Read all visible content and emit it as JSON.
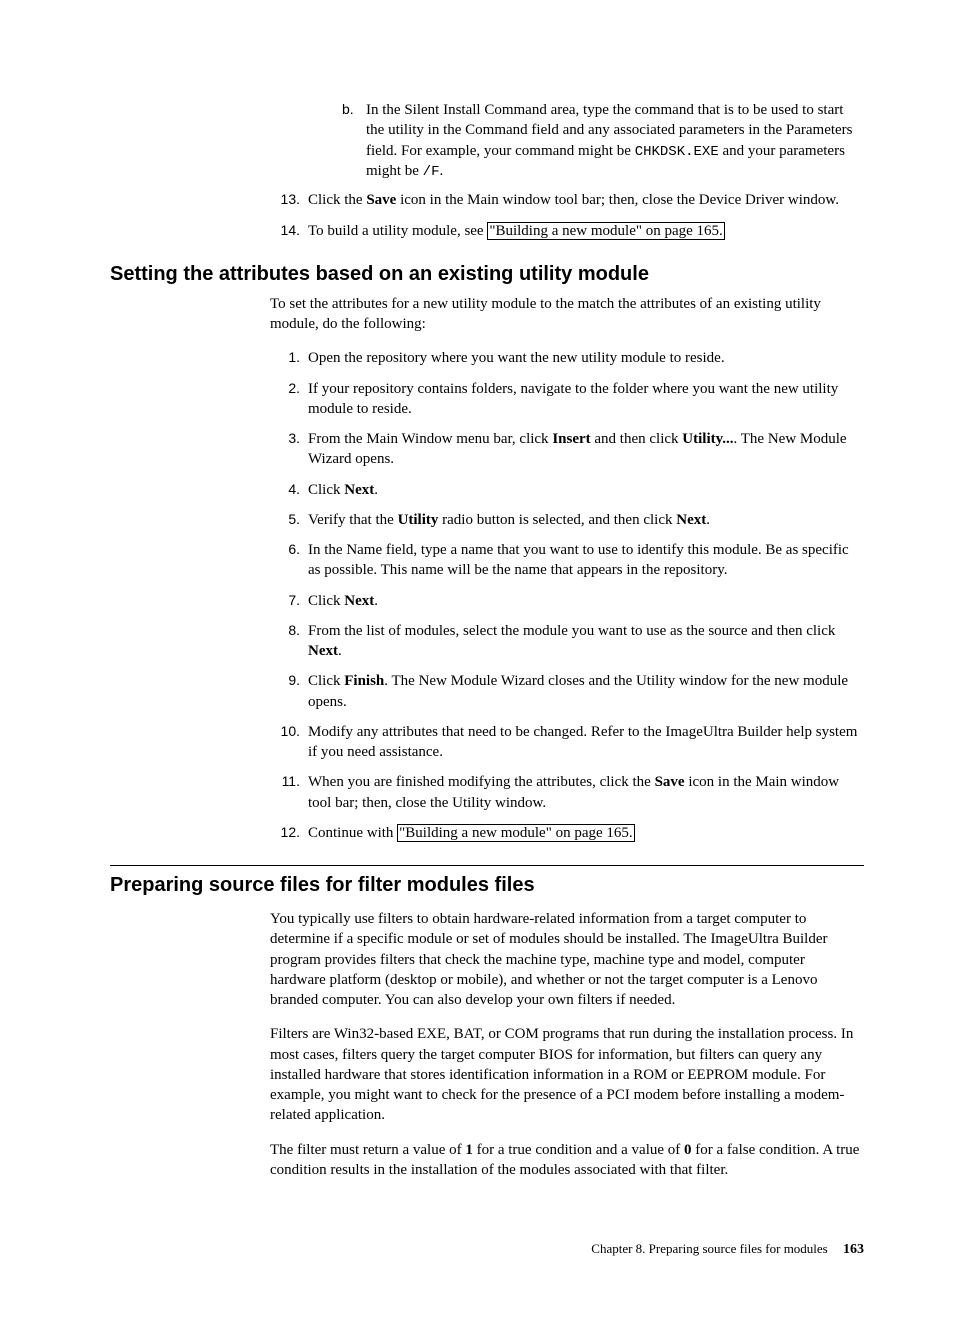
{
  "top_items": {
    "b": {
      "pre": "In the Silent Install Command area, type the command that is to be used to start the utility in the Command field and any associated parameters in the Parameters field. For example, your command might be ",
      "code1": "CHKDSK.EXE",
      "mid": " and your parameters might be ",
      "code2": "/F",
      "post": "."
    },
    "i13": {
      "pre": "Click the ",
      "bold": "Save",
      "post": " icon in the Main window tool bar; then, close the Device Driver window."
    },
    "i14": {
      "pre": "To build a utility module, see ",
      "link": "\"Building a new module\" on page 165."
    }
  },
  "section1": {
    "heading": "Setting the attributes based on an existing utility module",
    "intro": "To set the attributes for a new utility module to the match the attributes of an existing utility module, do the following:",
    "items": {
      "i1": "Open the repository where you want the new utility module to reside.",
      "i2": "If your repository contains folders, navigate to the folder where you want the new utility module to reside.",
      "i3": {
        "pre": "From the Main Window menu bar, click ",
        "b1": "Insert",
        "mid": " and then click ",
        "b2": "Utility...",
        "post": ". The New Module Wizard opens."
      },
      "i4": {
        "pre": "Click ",
        "b": "Next",
        "post": "."
      },
      "i5": {
        "pre": "Verify that the ",
        "b1": "Utility",
        "mid": " radio button is selected, and then click ",
        "b2": "Next",
        "post": "."
      },
      "i6": "In the Name field, type a name that you want to use to identify this module. Be as specific as possible. This name will be the name that appears in the repository.",
      "i7": {
        "pre": "Click ",
        "b": "Next",
        "post": "."
      },
      "i8": {
        "pre": "From the list of modules, select the module you want to use as the source and then click ",
        "b": "Next",
        "post": "."
      },
      "i9": {
        "pre": "Click ",
        "b": "Finish",
        "post": ". The New Module Wizard closes and the Utility window for the new module opens."
      },
      "i10": "Modify any attributes that need to be changed. Refer to the ImageUltra Builder help system if you need assistance.",
      "i11": {
        "pre": "When you are finished modifying the attributes, click the ",
        "b": "Save",
        "post": " icon in the Main window tool bar; then, close the Utility window."
      },
      "i12": {
        "pre": "Continue with ",
        "link": "\"Building a new module\" on page 165."
      }
    }
  },
  "section2": {
    "heading": "Preparing source files for filter modules files",
    "p1": "You typically use filters to obtain hardware-related information from a target computer to determine if a specific module or set of modules should be installed. The ImageUltra Builder program provides filters that check the machine type, machine type and model, computer hardware platform (desktop or mobile), and whether or not the target computer is a Lenovo branded computer. You can also develop your own filters if needed.",
    "p2": "Filters are Win32-based EXE, BAT, or COM programs that run during the installation process. In most cases, filters query the target computer BIOS for information, but filters can query any installed hardware that stores identification information in a ROM or EEPROM module. For example, you might want to check for the presence of a PCI modem before installing a modem-related application.",
    "p3": {
      "pre": "The filter must return a value of ",
      "b1": "1",
      "mid1": " for a true condition and a value of ",
      "b2": "0",
      "mid2": " for a false condition. A true condition results in the installation of the modules associated with that filter."
    }
  },
  "footer": {
    "chapter": "Chapter 8. Preparing source files for modules",
    "page": "163"
  }
}
